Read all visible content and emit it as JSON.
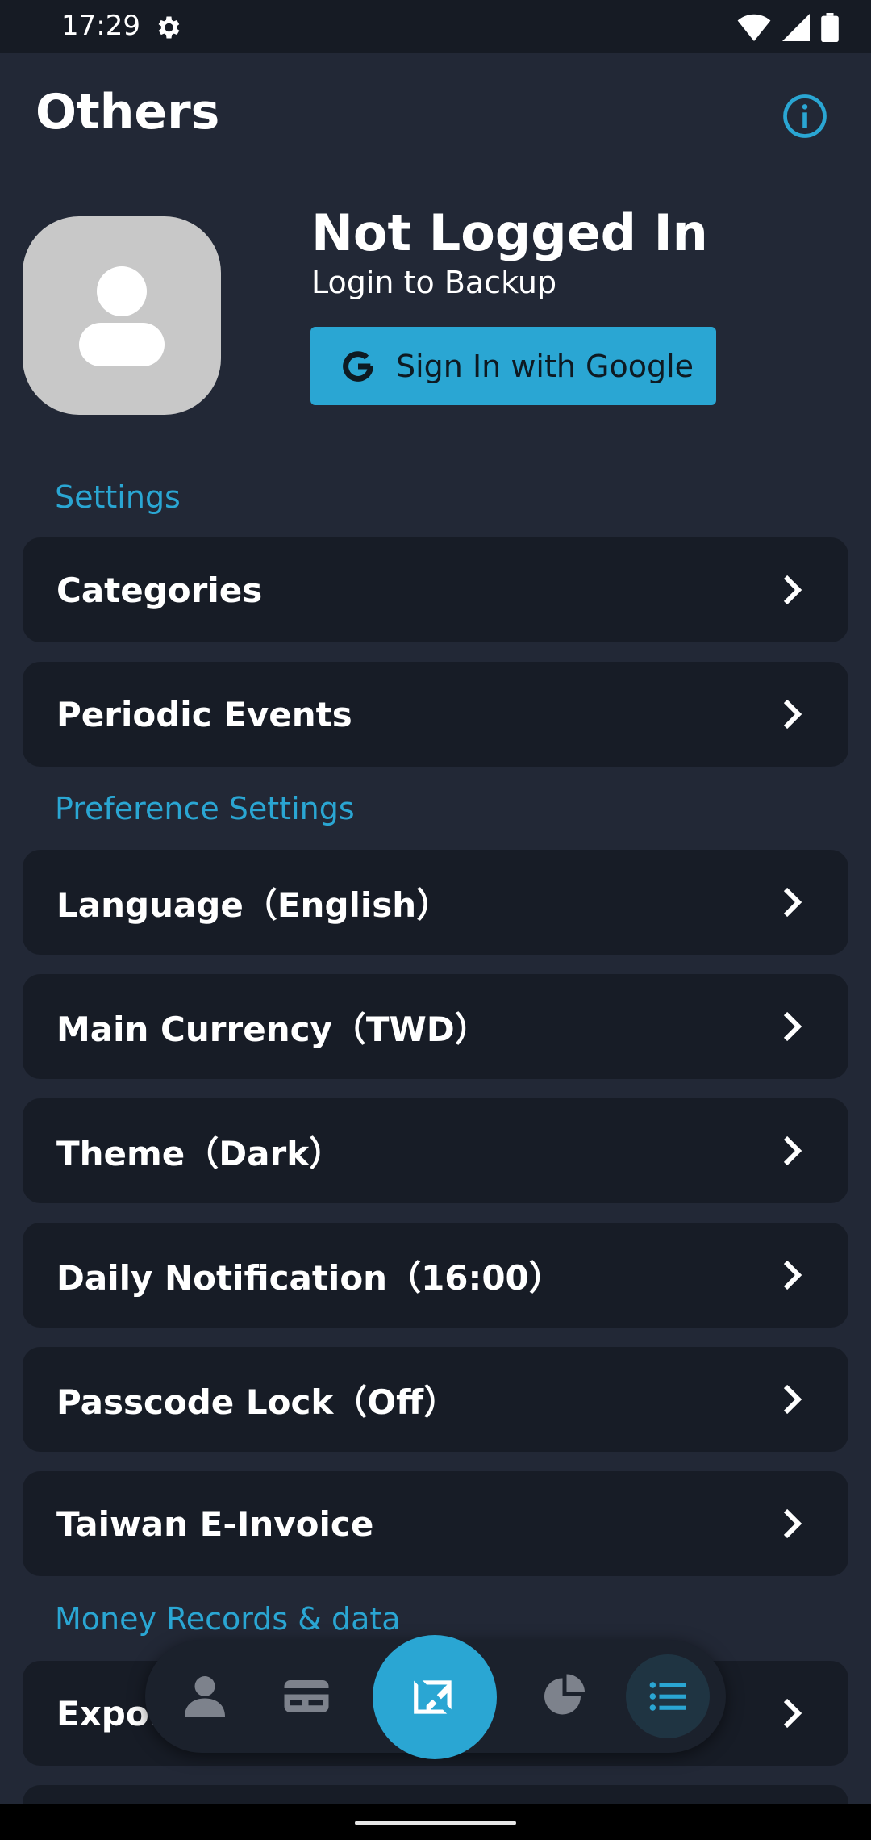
{
  "status": {
    "time": "17:29"
  },
  "header": {
    "title": "Others"
  },
  "account": {
    "status_title": "Not Logged In",
    "subtitle": "Login to Backup",
    "google_button_label": "Sign In with Google"
  },
  "sections": {
    "settings": "Settings",
    "preference": "Preference Settings",
    "money": "Money Records & data"
  },
  "settings_items": [
    {
      "label": "Categories"
    },
    {
      "label": "Periodic Events"
    }
  ],
  "preference_items": [
    {
      "label": "Language（English）"
    },
    {
      "label": "Main Currency（TWD）"
    },
    {
      "label": "Theme（Dark）"
    },
    {
      "label": "Daily Notification（16:00）"
    },
    {
      "label": "Passcode Lock（Off）"
    },
    {
      "label": "Taiwan E-Invoice"
    }
  ],
  "money_items": [
    {
      "label": "Expor"
    }
  ],
  "colors": {
    "accent": "#2aa6d3",
    "background": "#222836",
    "card": "#171c26"
  }
}
